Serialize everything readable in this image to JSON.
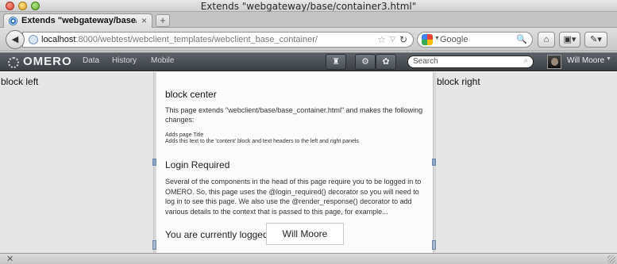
{
  "window": {
    "title": "Extends \"webgateway/base/container3.html\""
  },
  "tabs": [
    {
      "label": "Extends \"webgateway/base/co...",
      "close": "×"
    }
  ],
  "new_tab_label": "+",
  "nav": {
    "back_glyph": "◀",
    "url_host": "localhost",
    "url_rest": ":8000/webtest/webclient_templates/webclient_base_container/",
    "star": "☆",
    "dropdown": "▽",
    "reload": "↻",
    "search_placeholder": "Google",
    "search_icon": "🔍",
    "home_glyph": "⌂",
    "bookmarks_glyph": "▣▾",
    "extensions_glyph": "✎▾"
  },
  "omero": {
    "logo": "OMERO",
    "nav_items": [
      "Data",
      "History",
      "Mobile"
    ],
    "basket_glyph": "♜",
    "scripts_glyph": "⚙",
    "share_glyph": "✿",
    "search_placeholder": "Search",
    "search_icon": "⌕",
    "user_name": "Will Moore",
    "user_caret": "▼"
  },
  "content": {
    "left_title": "block left",
    "right_title": "block right",
    "center_title": "block center",
    "intro": "This page extends \"webclient/base/base_container.html\" and makes the following changes:",
    "change_1": "Adds page Title",
    "change_2": "Adds this text to the 'content' block and text headers to the left and right panels",
    "login_heading": "Login Required",
    "login_text": "Several of the components in the head of this page require you to be logged in to OMERO. So, this page uses the @login_required() decorator so you will need to log in to see this page. We also use the @render_response() decorator to add various details to the context that is passed to this page, for example...",
    "logged_in_label": "You are currently logged in as:",
    "logged_in_user": "Will Moore"
  },
  "status": {
    "close_glyph": "✕"
  }
}
